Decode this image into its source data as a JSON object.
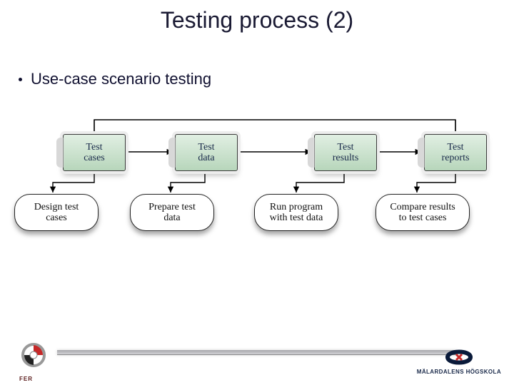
{
  "title": "Testing process (2)",
  "bullet": "Use-case scenario testing",
  "docs": {
    "d1": "Test\ncases",
    "d2": "Test\ndata",
    "d3": "Test\nresults",
    "d4": "Test\nreports"
  },
  "procs": {
    "p1": "Design test\ncases",
    "p2": "Prepare test\ndata",
    "p3": "Run program\nwith test data",
    "p4": "Compare results\nto test cases"
  },
  "footer": {
    "left_logo_label": "FER",
    "right_logo_label": "MÄLARDALENS HÖGSKOLA"
  },
  "chart_data": {
    "type": "table",
    "title": "Testing process flow",
    "artifacts": [
      "Test cases",
      "Test data",
      "Test results",
      "Test reports"
    ],
    "activities": [
      "Design test cases",
      "Prepare test data",
      "Run program with test data",
      "Compare results to test cases"
    ],
    "flow": [
      "Design test cases -> Test cases",
      "Test cases -> Prepare test data",
      "Prepare test data -> Test data",
      "Test data -> Run program with test data",
      "Run program with test data -> Test results",
      "Test results -> Compare results to test cases",
      "Compare results to test cases -> Test reports"
    ]
  }
}
